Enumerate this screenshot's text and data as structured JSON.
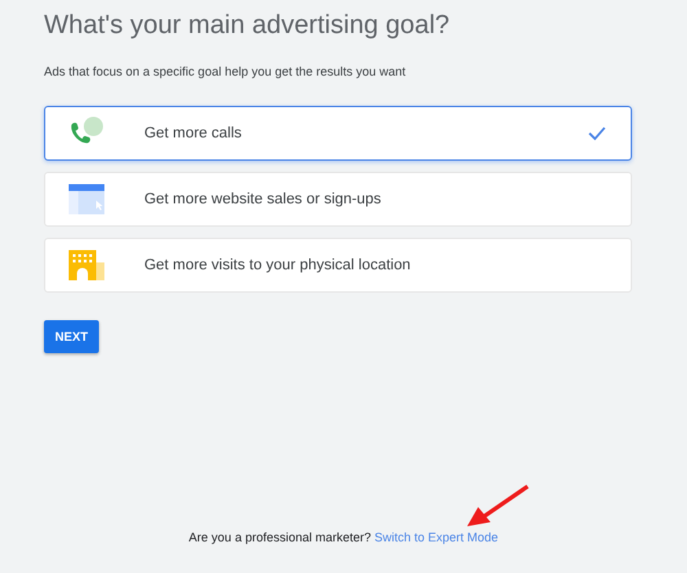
{
  "title": "What's your main advertising goal?",
  "subtitle": "Ads that focus on a specific goal help you get the results you want",
  "goals": [
    {
      "label": "Get more calls",
      "kind": "phone",
      "selected": true
    },
    {
      "label": "Get more website sales or sign-ups",
      "kind": "website",
      "selected": false
    },
    {
      "label": "Get more visits to your physical location",
      "kind": "building",
      "selected": false
    }
  ],
  "next_button": "NEXT",
  "footer": {
    "question": "Are you a professional marketer?",
    "link": "Switch to Expert Mode"
  }
}
